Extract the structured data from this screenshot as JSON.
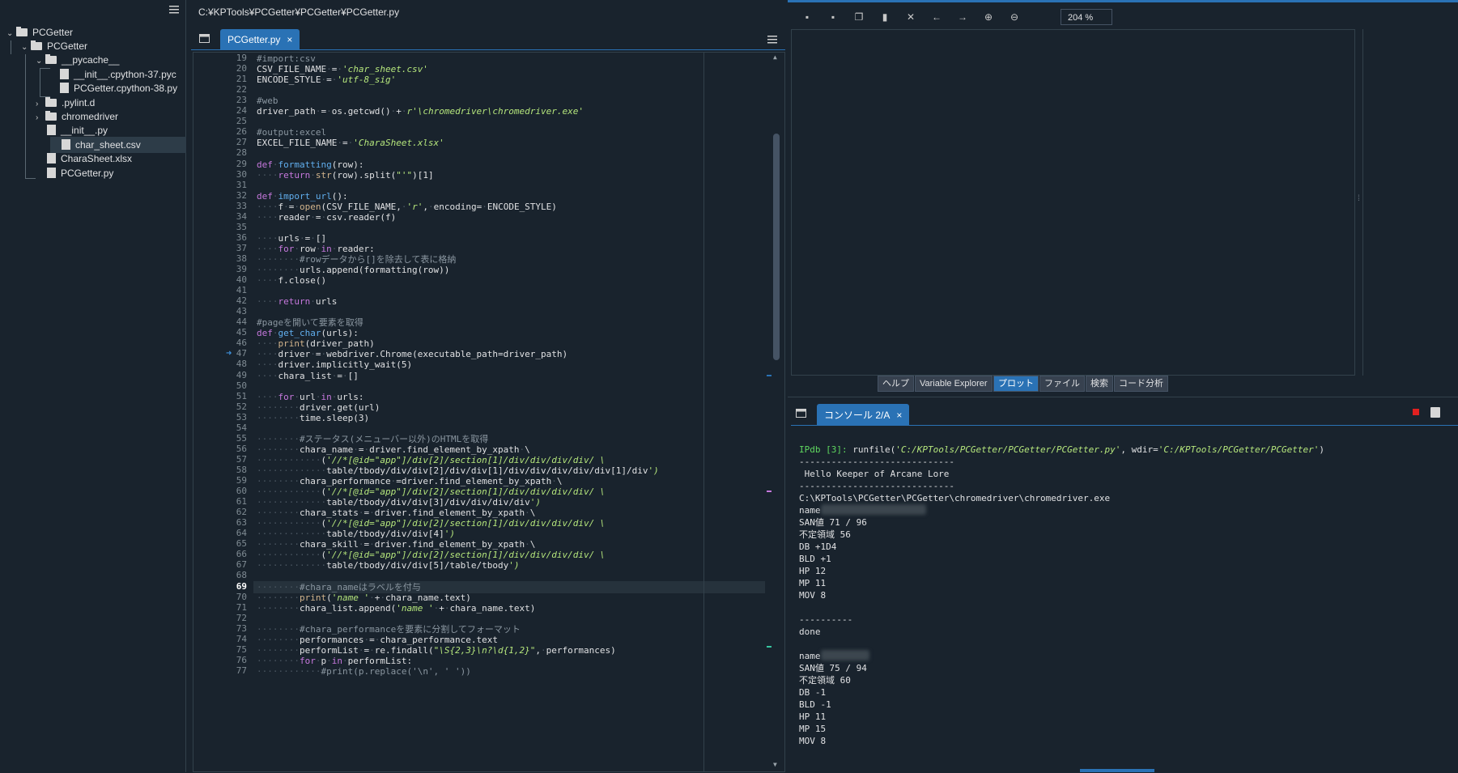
{
  "tree": {
    "items": [
      {
        "label": "PCGetter",
        "kind": "folder",
        "expanded": true
      },
      {
        "label": "PCGetter",
        "kind": "folder",
        "expanded": true
      },
      {
        "label": "__pycache__",
        "kind": "folder",
        "expanded": true
      },
      {
        "label": "__init__.cpython-37.pyc",
        "kind": "file"
      },
      {
        "label": "PCGetter.cpython-38.py",
        "kind": "file"
      },
      {
        "label": ".pylint.d",
        "kind": "folder",
        "expanded": false
      },
      {
        "label": "chromedriver",
        "kind": "folder",
        "expanded": false
      },
      {
        "label": "__init__.py",
        "kind": "python"
      },
      {
        "label": "char_sheet.csv",
        "kind": "csv",
        "selected": true
      },
      {
        "label": "CharaSheet.xlsx",
        "kind": "excel"
      },
      {
        "label": "PCGetter.py",
        "kind": "python"
      }
    ]
  },
  "editor": {
    "path": "C:¥KPTools¥PCGetter¥PCGetter¥PCGetter.py",
    "tab_label": "PCGetter.py",
    "tab_close": "×",
    "current_line": 69,
    "breakpoint_line": 47,
    "lines": [
      {
        "n": 19,
        "t": "#import:csv"
      },
      {
        "n": 20,
        "t": "CSV_FILE_NAME = 'char_sheet.csv'"
      },
      {
        "n": 21,
        "t": "ENCODE_STYLE = 'utf-8_sig'"
      },
      {
        "n": 22,
        "t": ""
      },
      {
        "n": 23,
        "t": "#web"
      },
      {
        "n": 24,
        "t": "driver_path = os.getcwd() + r'\\chromedriver\\chromedriver.exe'"
      },
      {
        "n": 25,
        "t": ""
      },
      {
        "n": 26,
        "t": "#output:excel"
      },
      {
        "n": 27,
        "t": "EXCEL_FILE_NAME = 'CharaSheet.xlsx'"
      },
      {
        "n": 28,
        "t": ""
      },
      {
        "n": 29,
        "t": "def formatting(row):"
      },
      {
        "n": 30,
        "t": "    return str(row).split(\"'\")[1]"
      },
      {
        "n": 31,
        "t": ""
      },
      {
        "n": 32,
        "t": "def import_url():"
      },
      {
        "n": 33,
        "t": "    f = open(CSV_FILE_NAME, 'r', encoding= ENCODE_STYLE)"
      },
      {
        "n": 34,
        "t": "    reader = csv.reader(f)"
      },
      {
        "n": 35,
        "t": ""
      },
      {
        "n": 36,
        "t": "    urls = []"
      },
      {
        "n": 37,
        "t": "    for row in reader:"
      },
      {
        "n": 38,
        "t": "        #rowデータから[]を除去して表に格納"
      },
      {
        "n": 39,
        "t": "        urls.append(formatting(row))"
      },
      {
        "n": 40,
        "t": "    f.close()"
      },
      {
        "n": 41,
        "t": ""
      },
      {
        "n": 42,
        "t": "    return urls"
      },
      {
        "n": 43,
        "t": ""
      },
      {
        "n": 44,
        "t": "#pageを開いて要素を取得"
      },
      {
        "n": 45,
        "t": "def get_char(urls):"
      },
      {
        "n": 46,
        "t": "    print(driver_path)"
      },
      {
        "n": 47,
        "t": "    driver = webdriver.Chrome(executable_path=driver_path)"
      },
      {
        "n": 48,
        "t": "    driver.implicitly_wait(5)"
      },
      {
        "n": 49,
        "t": "    chara_list = []"
      },
      {
        "n": 50,
        "t": ""
      },
      {
        "n": 51,
        "t": "    for url in urls:"
      },
      {
        "n": 52,
        "t": "        driver.get(url)"
      },
      {
        "n": 53,
        "t": "        time.sleep(3)"
      },
      {
        "n": 54,
        "t": ""
      },
      {
        "n": 55,
        "t": "        #ステータス(メニューバー以外)のHTMLを取得"
      },
      {
        "n": 56,
        "t": "        chara_name = driver.find_element_by_xpath \\"
      },
      {
        "n": 57,
        "t": "            ('//*[@id=\"app\"]/div[2]/section[1]/div/div/div/div/ \\"
      },
      {
        "n": 58,
        "t": "             table/tbody/div/div[2]/div/div[1]/div/div/div/div/div[1]/div')"
      },
      {
        "n": 59,
        "t": "        chara_performance =driver.find_element_by_xpath \\"
      },
      {
        "n": 60,
        "t": "            ('//*[@id=\"app\"]/div[2]/section[1]/div/div/div/div/ \\"
      },
      {
        "n": 61,
        "t": "             table/tbody/div/div[3]/div/div/div/div')"
      },
      {
        "n": 62,
        "t": "        chara_stats = driver.find_element_by_xpath \\"
      },
      {
        "n": 63,
        "t": "            ('//*[@id=\"app\"]/div[2]/section[1]/div/div/div/div/ \\"
      },
      {
        "n": 64,
        "t": "             table/tbody/div/div[4]')"
      },
      {
        "n": 65,
        "t": "        chara_skill = driver.find_element_by_xpath \\"
      },
      {
        "n": 66,
        "t": "            ('//*[@id=\"app\"]/div[2]/section[1]/div/div/div/div/ \\"
      },
      {
        "n": 67,
        "t": "             table/tbody/div/div[5]/table/tbody')"
      },
      {
        "n": 68,
        "t": ""
      },
      {
        "n": 69,
        "t": "        #chara_nameはラベルを付与"
      },
      {
        "n": 70,
        "t": "        print('name ' + chara_name.text)"
      },
      {
        "n": 71,
        "t": "        chara_list.append('name ' + chara_name.text)"
      },
      {
        "n": 72,
        "t": ""
      },
      {
        "n": 73,
        "t": "        #chara_performanceを要素に分割してフォーマット"
      },
      {
        "n": 74,
        "t": "        performances = chara_performance.text"
      },
      {
        "n": 75,
        "t": "        performList = re.findall(\"\\S{2,3}\\n?\\d{1,2}\", performances)"
      },
      {
        "n": 76,
        "t": "        for p in performList:"
      },
      {
        "n": 77,
        "t": "            #print(p.replace('\\n', ' '))"
      }
    ]
  },
  "plot": {
    "zoom": "204 %",
    "toolbar_icons": [
      "save-icon",
      "save-all-icon",
      "copy-icon",
      "delete-icon",
      "close-all-icon",
      "previous-icon",
      "next-icon",
      "zoom-in-icon",
      "zoom-out-icon"
    ],
    "pane_tabs": [
      {
        "label": "ヘルプ",
        "active": false
      },
      {
        "label": "Variable Explorer",
        "active": false
      },
      {
        "label": "プロット",
        "active": true
      },
      {
        "label": "ファイル",
        "active": false
      },
      {
        "label": "検索",
        "active": false
      },
      {
        "label": "コード分析",
        "active": false
      }
    ]
  },
  "console": {
    "tab_label": "コンソール 2/A",
    "tab_close": "×",
    "prompt": "IPdb [3]: ",
    "command_prefix": "runfile(",
    "command_arg1": "'C:/KPTools/PCGetter/PCGetter/PCGetter.py'",
    "command_mid": ", wdir=",
    "command_arg2": "'C:/KPTools/PCGetter/PCGetter'",
    "command_suffix": ")",
    "output": [
      "-----------------------------",
      " Hello Keeper of Arcane Lore",
      "-----------------------------",
      "C:\\KPTools\\PCGetter\\PCGetter\\chromedriver\\chromedriver.exe",
      "name",
      "SAN値 71 / 96",
      "不定領域 56",
      "DB +1D4",
      "BLD +1",
      "HP 12",
      "MP 11",
      "MOV 8",
      "",
      "----------",
      "done",
      "",
      "name",
      "SAN値 75 / 94",
      "不定領域 60",
      "DB -1",
      "BLD -1",
      "HP 11",
      "MP 15",
      "MOV 8"
    ]
  },
  "colors": {
    "accent": "#2a72b5",
    "background": "#19232d",
    "stop": "#e02020"
  }
}
